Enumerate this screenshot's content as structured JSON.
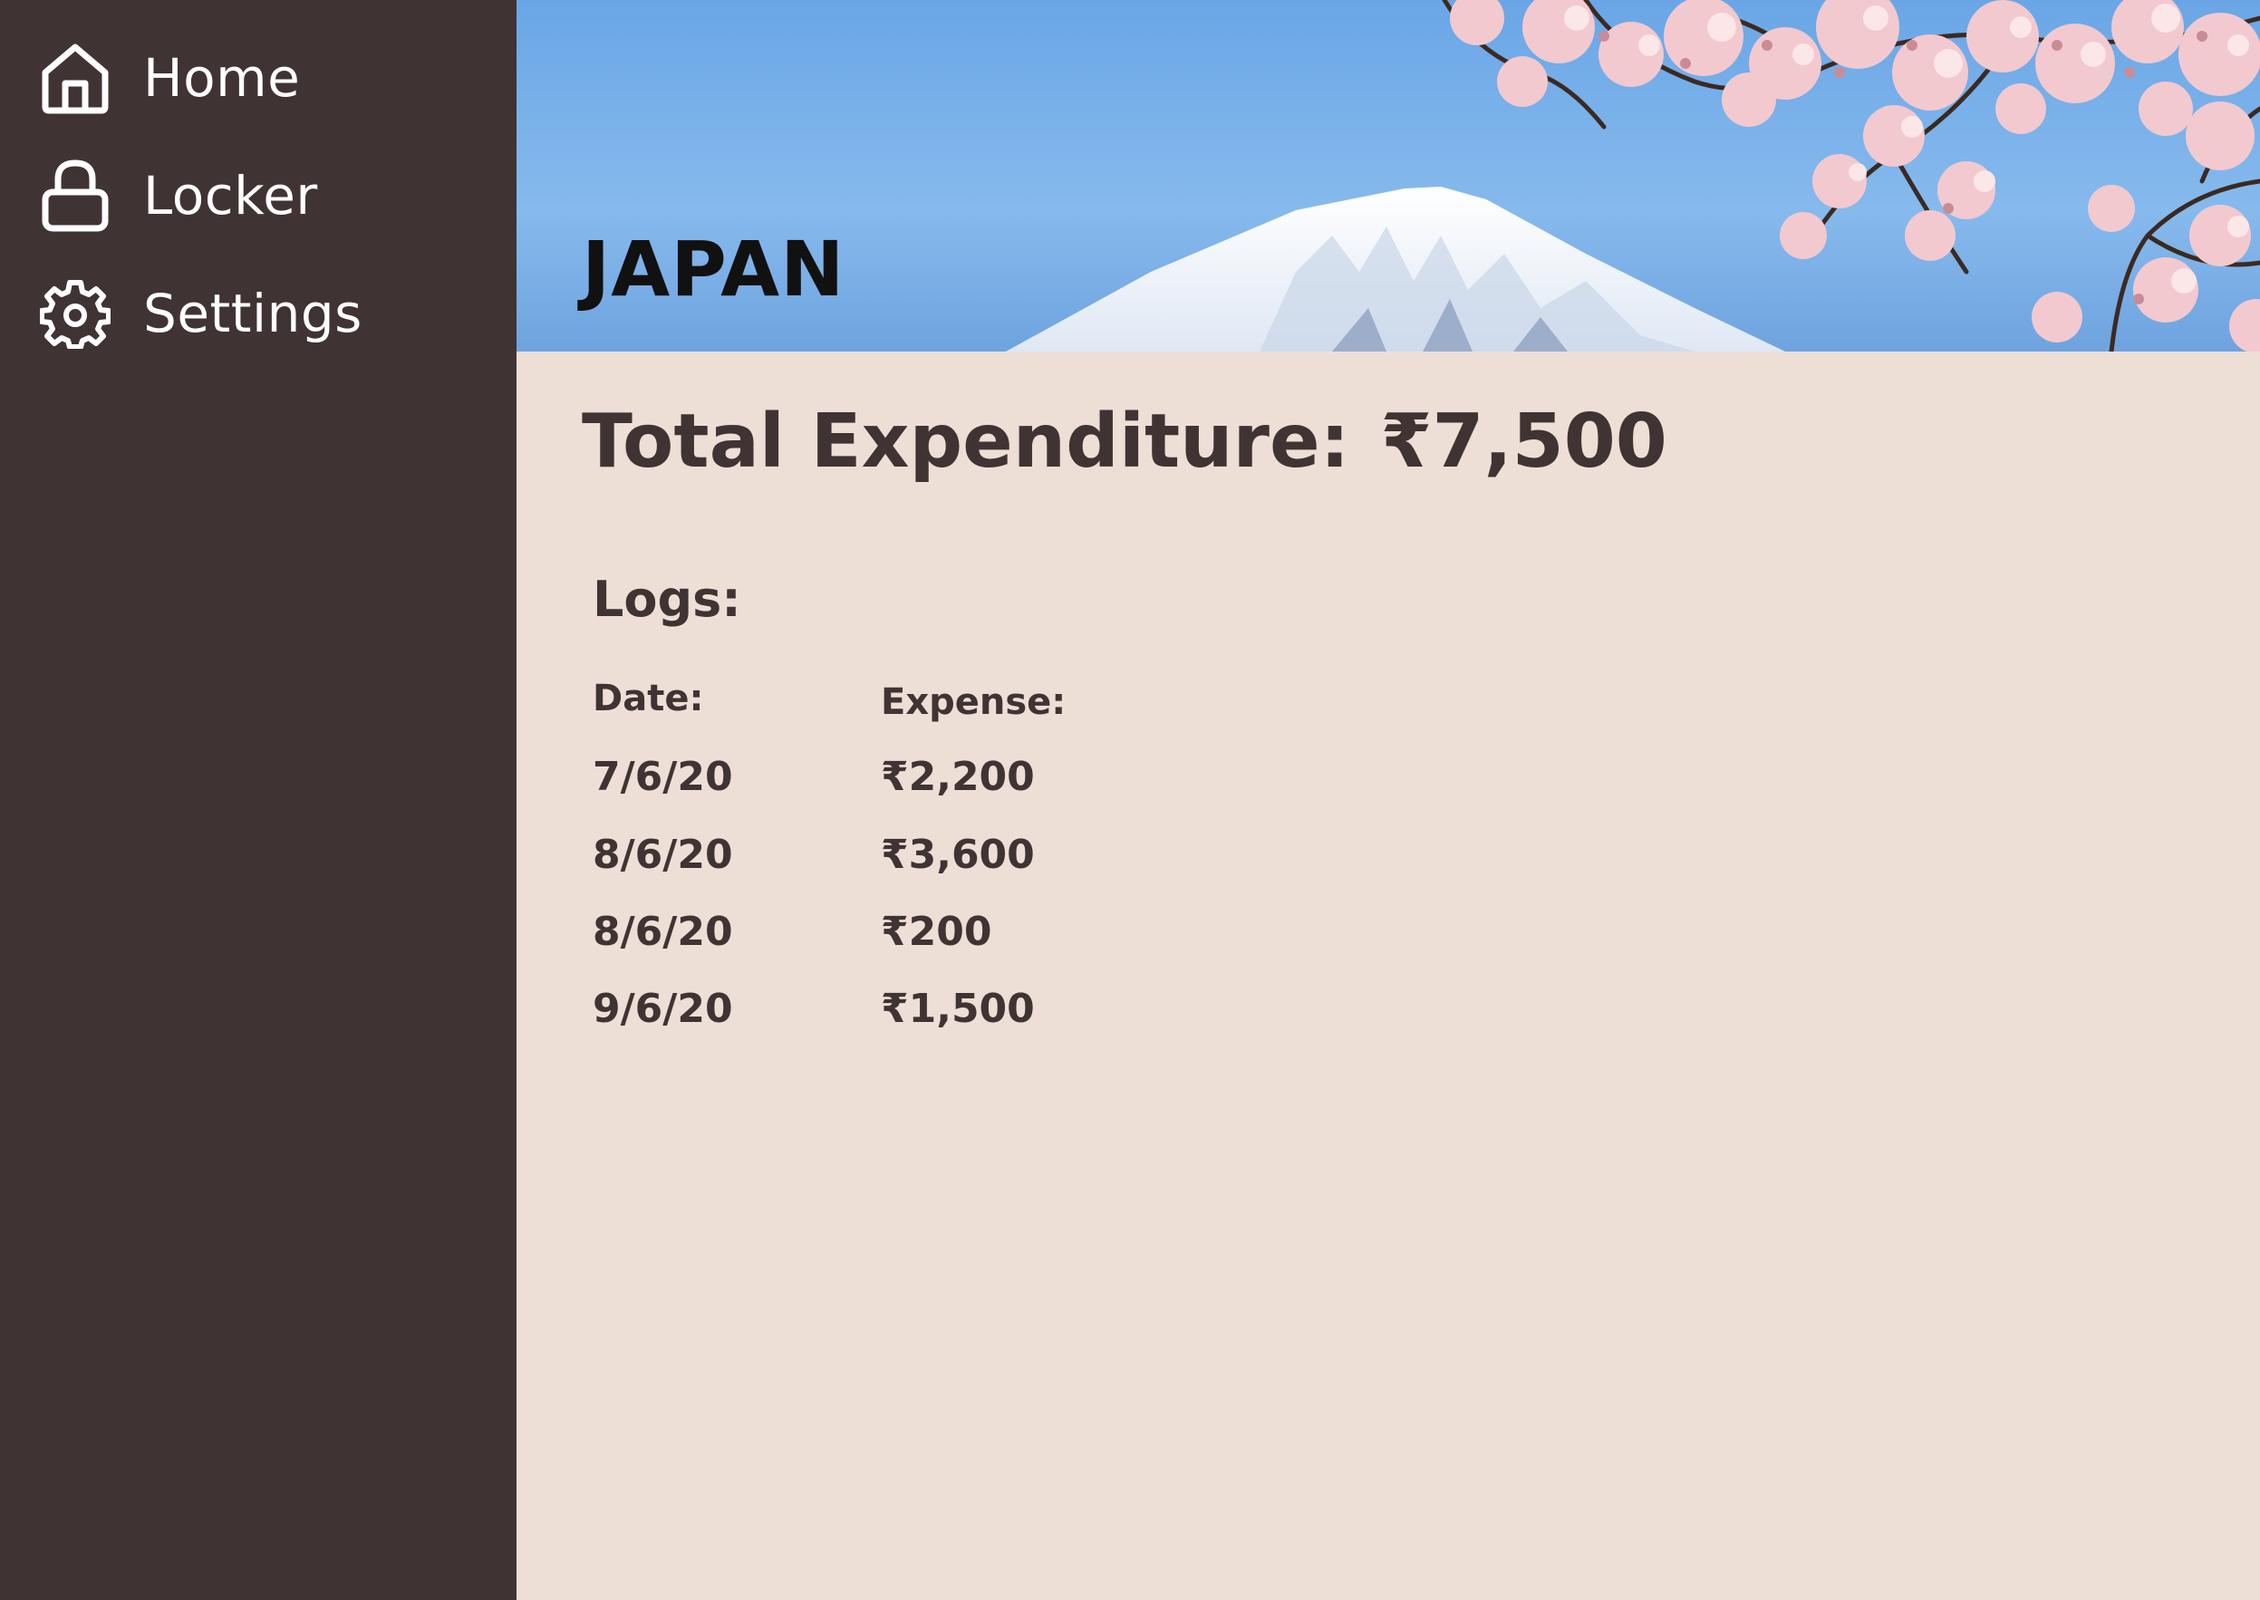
{
  "colors": {
    "sidebar_bg": "#403333",
    "content_bg": "#eddfd6",
    "text_dark": "#403333",
    "sky_blue": "#6ea8e6"
  },
  "sidebar": {
    "items": [
      {
        "label": "Home",
        "icon": "home-icon"
      },
      {
        "label": "Locker",
        "icon": "lock-icon"
      },
      {
        "label": "Settings",
        "icon": "gear-icon"
      }
    ]
  },
  "hero": {
    "title": "JAPAN",
    "image": "mount-fuji-cherry-blossoms"
  },
  "summary": {
    "total_label": "Total Expenditure:",
    "total_value": "₹7,500"
  },
  "logs": {
    "title": "Logs:",
    "columns": {
      "date": "Date:",
      "expense": "Expense:"
    },
    "rows": [
      {
        "date": "7/6/20",
        "expense": "₹2,200"
      },
      {
        "date": "8/6/20",
        "expense": "₹3,600"
      },
      {
        "date": "8/6/20",
        "expense": "₹200"
      },
      {
        "date": "9/6/20",
        "expense": "₹1,500"
      }
    ]
  }
}
